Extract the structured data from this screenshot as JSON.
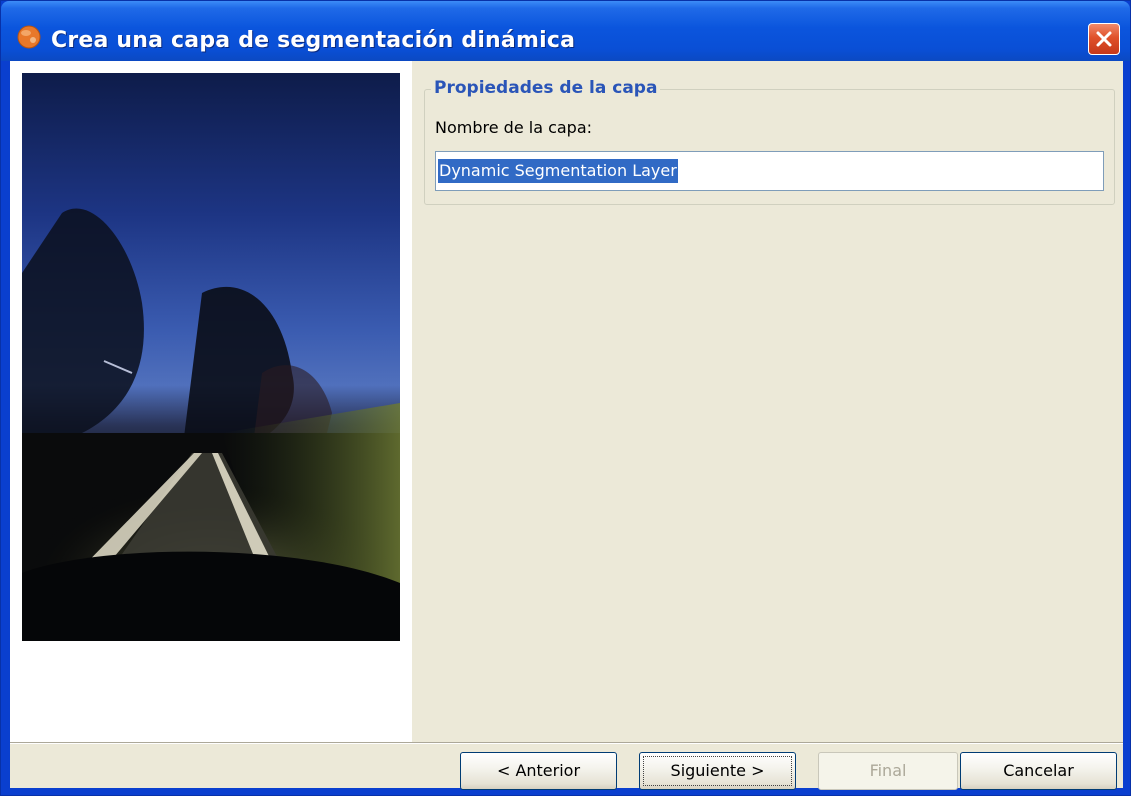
{
  "window": {
    "title": "Crea una capa de segmentación dinámica",
    "icon": "gvsig-app-icon",
    "close_icon": "close-icon"
  },
  "group": {
    "legend": "Propiedades de la capa",
    "field_label": "Nombre de la capa:",
    "field_value": "Dynamic Segmentation Layer"
  },
  "buttons": {
    "back": "< Anterior",
    "next": "Siguiente >",
    "finish": "Final",
    "cancel": "Cancelar"
  },
  "colors": {
    "titlebar": "#0a4fd6",
    "legend": "#2a55b8",
    "selection": "#316ac5",
    "dialog_bg": "#ece9d8"
  }
}
